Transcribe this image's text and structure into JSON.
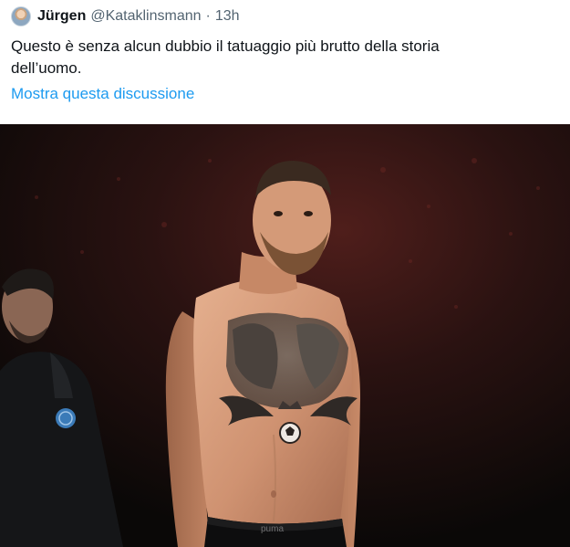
{
  "tweet": {
    "display_name": "Jürgen",
    "handle": "@Kataklinsmann",
    "separator": "·",
    "timestamp": "13h",
    "text": "Questo è senza alcun dubbio il tatuaggio più brutto della storia\ndell’uomo.",
    "thread_link": "Mostra questa discussione"
  },
  "media": {
    "shorts_brand": "puma"
  },
  "colors": {
    "link": "#1d9bf0",
    "text": "#0f1419",
    "secondary_text": "#536471"
  }
}
